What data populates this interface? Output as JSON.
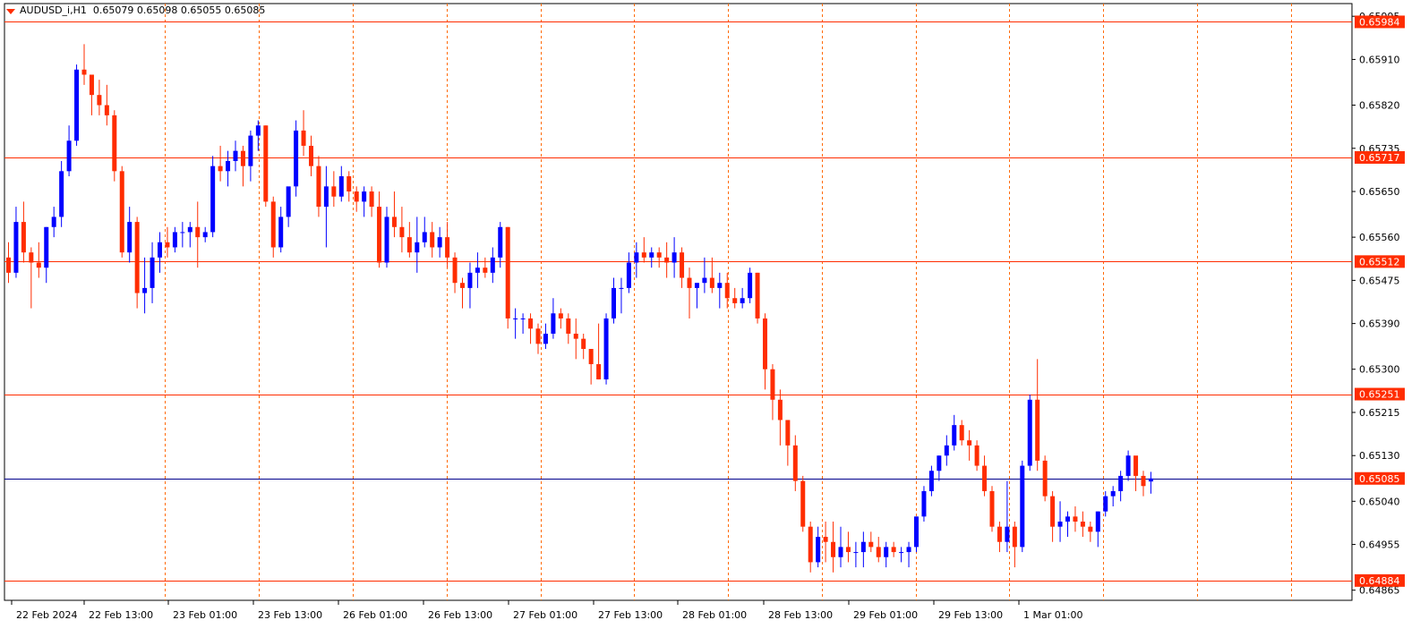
{
  "colors": {
    "bull": "#0000ff",
    "bear": "#ff2d00",
    "wick_bull": "#0000ff",
    "wick_bear": "#ff2d00",
    "level_line": "#ff2d00",
    "current_line": "#00008b",
    "grid_line": "#ff6a00",
    "label_bg": "#ff2d00",
    "label_text": "#ffffff"
  },
  "header": {
    "symbol": "AUDUSD_i,H1",
    "ohlc": "0.65079 0.65098 0.65055 0.65085"
  },
  "chart_data": {
    "type": "candlestick",
    "title": "",
    "symbol": "AUDUSD_i",
    "timeframe": "H1",
    "ylim": [
      0.64845,
      0.6602
    ],
    "y_ticks": [
      "0.65995",
      "0.65910",
      "0.65820",
      "0.65735",
      "0.65650",
      "0.65560",
      "0.65475",
      "0.65390",
      "0.65300",
      "0.65215",
      "0.65130",
      "0.65040",
      "0.64955",
      "0.64865"
    ],
    "x_ticks": [
      "22 Feb 2024",
      "22 Feb 13:00",
      "23 Feb 01:00",
      "23 Feb 13:00",
      "26 Feb 01:00",
      "26 Feb 13:00",
      "27 Feb 01:00",
      "27 Feb 13:00",
      "28 Feb 01:00",
      "28 Feb 13:00",
      "29 Feb 01:00",
      "29 Feb 13:00",
      "1 Mar 01:00"
    ],
    "period_separators": [
      "22 Feb 13:00",
      "23 Feb 01:00",
      "23 Feb 13:00",
      "26 Feb 01:00",
      "26 Feb 13:00",
      "27 Feb 01:00",
      "27 Feb 13:00",
      "28 Feb 01:00",
      "28 Feb 13:00",
      "29 Feb 01:00",
      "29 Feb 13:00",
      "1 Mar 01:00",
      "1 Mar 13:00"
    ],
    "grid": false,
    "levels": [
      {
        "price": 0.65984,
        "label": "0.65984"
      },
      {
        "price": 0.65717,
        "label": "0.65717"
      },
      {
        "price": 0.65512,
        "label": "0.65512"
      },
      {
        "price": 0.65251,
        "label": "0.65251"
      },
      {
        "price": 0.64884,
        "label": "0.64884"
      }
    ],
    "current_price": {
      "price": 0.65085,
      "label": "0.65085"
    },
    "candles": [
      [
        0.6552,
        0.6555,
        0.6547,
        0.6549
      ],
      [
        0.6549,
        0.6562,
        0.6548,
        0.6559
      ],
      [
        0.6559,
        0.6563,
        0.6551,
        0.6553
      ],
      [
        0.6553,
        0.6554,
        0.6542,
        0.6551
      ],
      [
        0.6551,
        0.6555,
        0.6548,
        0.655
      ],
      [
        0.655,
        0.6558,
        0.6547,
        0.6558
      ],
      [
        0.6558,
        0.6562,
        0.6556,
        0.656
      ],
      [
        0.656,
        0.6571,
        0.6558,
        0.6569
      ],
      [
        0.6569,
        0.6578,
        0.6568,
        0.6575
      ],
      [
        0.6575,
        0.659,
        0.6574,
        0.6589
      ],
      [
        0.6589,
        0.6594,
        0.6586,
        0.6588
      ],
      [
        0.6588,
        0.6587,
        0.658,
        0.6584
      ],
      [
        0.6584,
        0.6587,
        0.658,
        0.6582
      ],
      [
        0.6582,
        0.6586,
        0.6578,
        0.658
      ],
      [
        0.658,
        0.6581,
        0.6567,
        0.6569
      ],
      [
        0.6569,
        0.657,
        0.6552,
        0.6553
      ],
      [
        0.6553,
        0.6562,
        0.6551,
        0.6559
      ],
      [
        0.6559,
        0.656,
        0.6542,
        0.6545
      ],
      [
        0.6545,
        0.6552,
        0.6541,
        0.6546
      ],
      [
        0.6546,
        0.6555,
        0.6543,
        0.6552
      ],
      [
        0.6552,
        0.6557,
        0.6549,
        0.6555
      ],
      [
        0.6555,
        0.6558,
        0.6552,
        0.6554
      ],
      [
        0.6554,
        0.6558,
        0.6553,
        0.6557
      ],
      [
        0.6557,
        0.6559,
        0.6554,
        0.6557
      ],
      [
        0.6557,
        0.6559,
        0.6554,
        0.6558
      ],
      [
        0.6558,
        0.6563,
        0.655,
        0.6556
      ],
      [
        0.6556,
        0.6558,
        0.6555,
        0.6557
      ],
      [
        0.6557,
        0.6572,
        0.6556,
        0.657
      ],
      [
        0.657,
        0.6574,
        0.6567,
        0.6569
      ],
      [
        0.6569,
        0.6573,
        0.6566,
        0.6571
      ],
      [
        0.6571,
        0.6575,
        0.6569,
        0.6573
      ],
      [
        0.6573,
        0.6574,
        0.6566,
        0.657
      ],
      [
        0.657,
        0.6577,
        0.6567,
        0.6576
      ],
      [
        0.6576,
        0.6579,
        0.6573,
        0.6578
      ],
      [
        0.6578,
        0.6578,
        0.6562,
        0.6563
      ],
      [
        0.6563,
        0.6564,
        0.6552,
        0.6554
      ],
      [
        0.6554,
        0.6562,
        0.6553,
        0.656
      ],
      [
        0.656,
        0.6564,
        0.6558,
        0.6566
      ],
      [
        0.6566,
        0.6579,
        0.6564,
        0.6577
      ],
      [
        0.6577,
        0.6581,
        0.6572,
        0.6574
      ],
      [
        0.6574,
        0.6576,
        0.6568,
        0.657
      ],
      [
        0.657,
        0.6572,
        0.656,
        0.6562
      ],
      [
        0.6562,
        0.657,
        0.6554,
        0.6566
      ],
      [
        0.6566,
        0.6569,
        0.6562,
        0.6564
      ],
      [
        0.6564,
        0.657,
        0.6563,
        0.6568
      ],
      [
        0.6568,
        0.6569,
        0.6563,
        0.6565
      ],
      [
        0.6565,
        0.6566,
        0.6561,
        0.6563
      ],
      [
        0.6563,
        0.6566,
        0.656,
        0.6565
      ],
      [
        0.6565,
        0.6566,
        0.656,
        0.6562
      ],
      [
        0.6562,
        0.6565,
        0.655,
        0.6551
      ],
      [
        0.6551,
        0.6562,
        0.655,
        0.656
      ],
      [
        0.656,
        0.6565,
        0.6556,
        0.6558
      ],
      [
        0.6558,
        0.6562,
        0.6553,
        0.6556
      ],
      [
        0.6556,
        0.6559,
        0.6552,
        0.6553
      ],
      [
        0.6553,
        0.656,
        0.6549,
        0.6555
      ],
      [
        0.6555,
        0.656,
        0.6554,
        0.6557
      ],
      [
        0.6557,
        0.6559,
        0.6552,
        0.6554
      ],
      [
        0.6554,
        0.6558,
        0.6552,
        0.6556
      ],
      [
        0.6556,
        0.6559,
        0.655,
        0.6552
      ],
      [
        0.6552,
        0.6553,
        0.6545,
        0.6547
      ],
      [
        0.6547,
        0.6548,
        0.6542,
        0.6546
      ],
      [
        0.6546,
        0.6551,
        0.6542,
        0.6549
      ],
      [
        0.6549,
        0.6553,
        0.6546,
        0.655
      ],
      [
        0.655,
        0.6552,
        0.6548,
        0.6549
      ],
      [
        0.6549,
        0.6554,
        0.6547,
        0.6552
      ],
      [
        0.6552,
        0.6559,
        0.655,
        0.6558
      ],
      [
        0.6558,
        0.6558,
        0.6538,
        0.654
      ],
      [
        0.654,
        0.6542,
        0.6536,
        0.654
      ],
      [
        0.654,
        0.6541,
        0.6537,
        0.654
      ],
      [
        0.654,
        0.6541,
        0.6535,
        0.6538
      ],
      [
        0.6538,
        0.6539,
        0.6533,
        0.6535
      ],
      [
        0.6535,
        0.6539,
        0.6534,
        0.6537
      ],
      [
        0.6537,
        0.6544,
        0.6536,
        0.6541
      ],
      [
        0.6541,
        0.6542,
        0.6538,
        0.654
      ],
      [
        0.654,
        0.6541,
        0.6535,
        0.6537
      ],
      [
        0.6537,
        0.654,
        0.6532,
        0.6536
      ],
      [
        0.6536,
        0.6537,
        0.6532,
        0.6534
      ],
      [
        0.6534,
        0.6534,
        0.6527,
        0.6531
      ],
      [
        0.6531,
        0.6539,
        0.6528,
        0.6528
      ],
      [
        0.6528,
        0.6541,
        0.6527,
        0.654
      ],
      [
        0.654,
        0.6548,
        0.6539,
        0.6546
      ],
      [
        0.6546,
        0.6548,
        0.6541,
        0.6546
      ],
      [
        0.6546,
        0.6553,
        0.6545,
        0.6551
      ],
      [
        0.6551,
        0.6555,
        0.6548,
        0.6553
      ],
      [
        0.6553,
        0.6556,
        0.6551,
        0.6552
      ],
      [
        0.6552,
        0.6554,
        0.655,
        0.6553
      ],
      [
        0.6553,
        0.6554,
        0.655,
        0.6552
      ],
      [
        0.6552,
        0.6555,
        0.6548,
        0.6551
      ],
      [
        0.6551,
        0.6556,
        0.6548,
        0.6553
      ],
      [
        0.6553,
        0.6554,
        0.6546,
        0.6548
      ],
      [
        0.6548,
        0.655,
        0.654,
        0.6546
      ],
      [
        0.6546,
        0.6547,
        0.6542,
        0.6547
      ],
      [
        0.6547,
        0.6552,
        0.6545,
        0.6548
      ],
      [
        0.6548,
        0.6552,
        0.6545,
        0.6546
      ],
      [
        0.6546,
        0.6549,
        0.6542,
        0.6547
      ],
      [
        0.6547,
        0.6549,
        0.6542,
        0.6544
      ],
      [
        0.6544,
        0.6546,
        0.6542,
        0.6543
      ],
      [
        0.6543,
        0.6546,
        0.6542,
        0.6544
      ],
      [
        0.6544,
        0.655,
        0.6543,
        0.6549
      ],
      [
        0.6549,
        0.6549,
        0.6539,
        0.654
      ],
      [
        0.654,
        0.6541,
        0.6526,
        0.653
      ],
      [
        0.653,
        0.6531,
        0.652,
        0.6524
      ],
      [
        0.6524,
        0.6526,
        0.6515,
        0.652
      ],
      [
        0.652,
        0.652,
        0.6511,
        0.6515
      ],
      [
        0.6515,
        0.6517,
        0.6506,
        0.6508
      ],
      [
        0.6508,
        0.6509,
        0.6498,
        0.6499
      ],
      [
        0.6499,
        0.65,
        0.649,
        0.6492
      ],
      [
        0.6492,
        0.6499,
        0.6491,
        0.6497
      ],
      [
        0.6497,
        0.65,
        0.6492,
        0.6496
      ],
      [
        0.6496,
        0.65,
        0.649,
        0.6493
      ],
      [
        0.6493,
        0.6499,
        0.6491,
        0.6495
      ],
      [
        0.6495,
        0.6498,
        0.6492,
        0.6494
      ],
      [
        0.6494,
        0.6496,
        0.6491,
        0.6494
      ],
      [
        0.6494,
        0.6498,
        0.6491,
        0.6496
      ],
      [
        0.6496,
        0.6498,
        0.6494,
        0.6495
      ],
      [
        0.6495,
        0.6497,
        0.6492,
        0.6493
      ],
      [
        0.6493,
        0.6496,
        0.6491,
        0.6495
      ],
      [
        0.6495,
        0.6496,
        0.6493,
        0.6494
      ],
      [
        0.6494,
        0.6495,
        0.6492,
        0.6494
      ],
      [
        0.6494,
        0.6496,
        0.6491,
        0.6495
      ],
      [
        0.6495,
        0.6501,
        0.6494,
        0.6501
      ],
      [
        0.6501,
        0.6507,
        0.65,
        0.6506
      ],
      [
        0.6506,
        0.6511,
        0.6505,
        0.651
      ],
      [
        0.651,
        0.6513,
        0.6508,
        0.6513
      ],
      [
        0.6513,
        0.6517,
        0.6511,
        0.6515
      ],
      [
        0.6515,
        0.6521,
        0.6514,
        0.6519
      ],
      [
        0.6519,
        0.652,
        0.6515,
        0.6516
      ],
      [
        0.6516,
        0.6518,
        0.6512,
        0.6515
      ],
      [
        0.6515,
        0.6516,
        0.651,
        0.6511
      ],
      [
        0.6511,
        0.6513,
        0.6505,
        0.6506
      ],
      [
        0.6506,
        0.6507,
        0.6498,
        0.6499
      ],
      [
        0.6499,
        0.65,
        0.6494,
        0.6496
      ],
      [
        0.6496,
        0.6508,
        0.6494,
        0.6499
      ],
      [
        0.6499,
        0.65,
        0.6491,
        0.6495
      ],
      [
        0.6495,
        0.6512,
        0.6494,
        0.6511
      ],
      [
        0.6511,
        0.6525,
        0.651,
        0.6524
      ],
      [
        0.6524,
        0.6532,
        0.651,
        0.6512
      ],
      [
        0.6512,
        0.6513,
        0.6504,
        0.6505
      ],
      [
        0.6505,
        0.6506,
        0.6496,
        0.6499
      ],
      [
        0.6499,
        0.6504,
        0.6496,
        0.65
      ],
      [
        0.65,
        0.6502,
        0.6497,
        0.6501
      ],
      [
        0.6501,
        0.6503,
        0.6498,
        0.65
      ],
      [
        0.65,
        0.6502,
        0.6497,
        0.6499
      ],
      [
        0.6499,
        0.65,
        0.6496,
        0.6498
      ],
      [
        0.6498,
        0.6502,
        0.6495,
        0.6502
      ],
      [
        0.6502,
        0.6506,
        0.6501,
        0.6505
      ],
      [
        0.6505,
        0.6507,
        0.6503,
        0.6506
      ],
      [
        0.6506,
        0.651,
        0.6504,
        0.6509
      ],
      [
        0.6509,
        0.6514,
        0.6508,
        0.6513
      ],
      [
        0.6513,
        0.6512,
        0.6506,
        0.6509
      ],
      [
        0.6509,
        0.651,
        0.6505,
        0.6507
      ],
      [
        0.65079,
        0.65098,
        0.65055,
        0.65085
      ]
    ]
  }
}
